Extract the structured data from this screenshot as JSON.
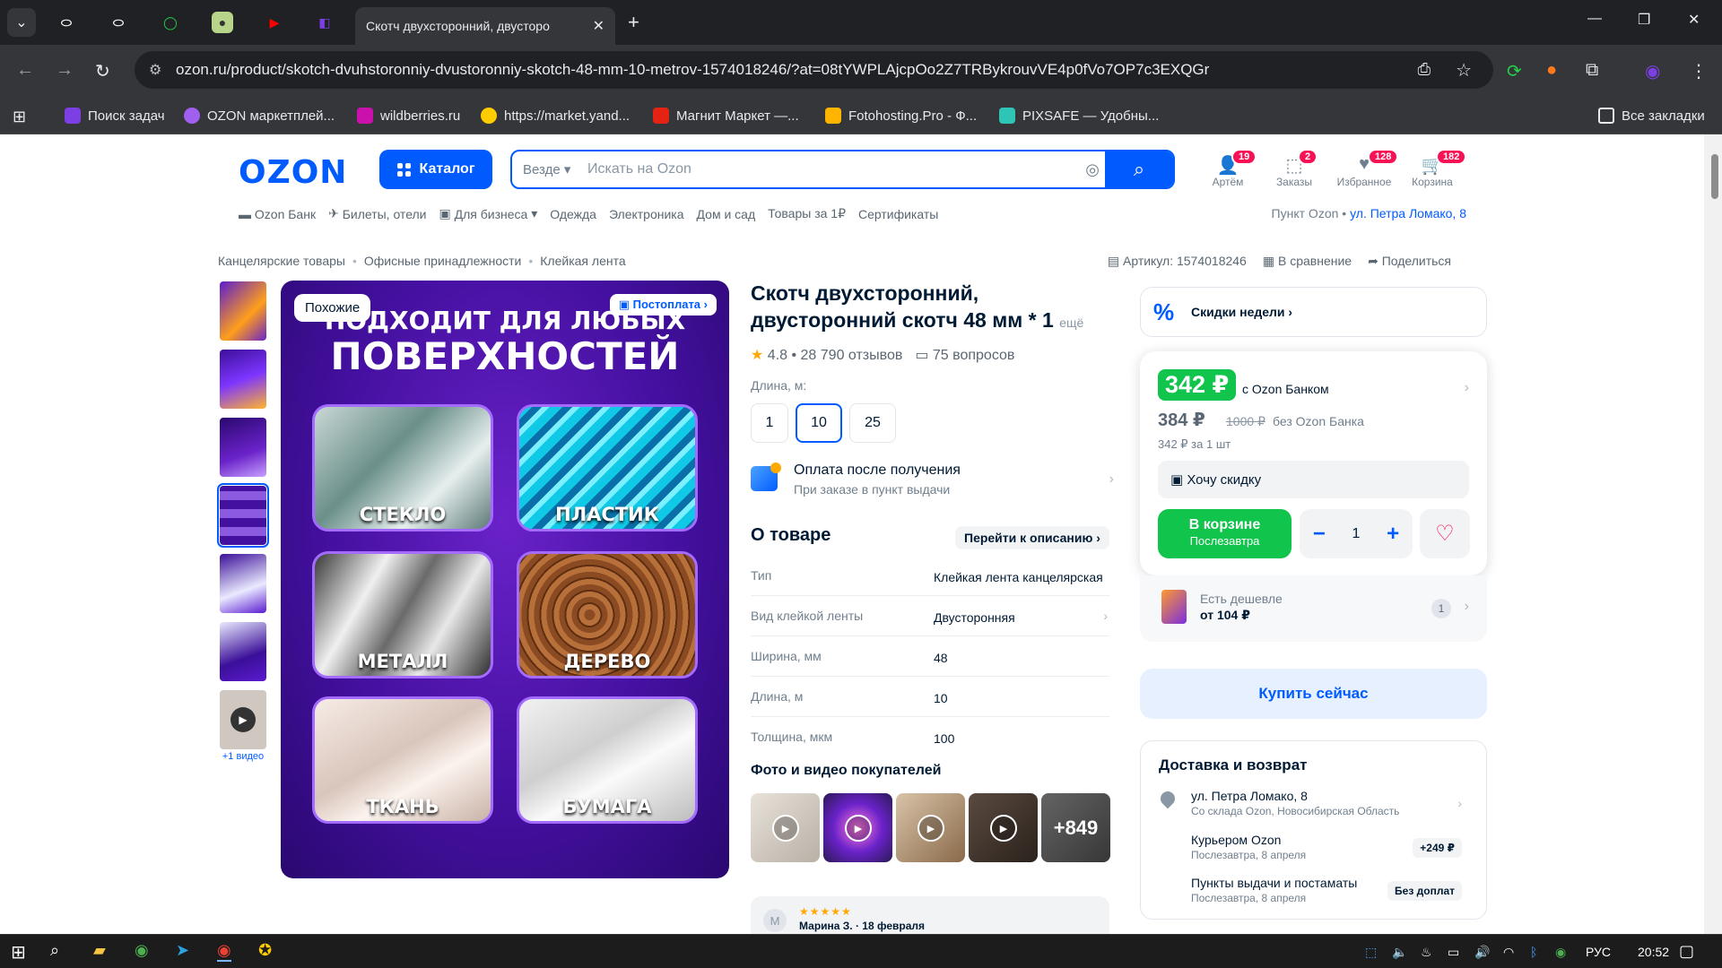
{
  "browser": {
    "active_tab_title": "Скотч двухсторонний, двусторо",
    "url": "ozon.ru/product/skotch-dvuhstoronniy-dvustoronniy-skotch-48-mm-10-metrov-1574018246/?at=08tYWPLAjcpOo2Z7TRBykrouvVE4p0fVo7OP7c3EXQGr",
    "bookmarks": [
      {
        "label": "Поиск задач",
        "color": "#7b3fe4"
      },
      {
        "label": "OZON маркетплей...",
        "color": "#a15ff0"
      },
      {
        "label": "wildberries.ru",
        "color": "#cb11ab"
      },
      {
        "label": "https://market.yand...",
        "color": "#ffcc00"
      },
      {
        "label": "Магнит Маркет —...",
        "color": "#e42313"
      },
      {
        "label": "Fotohosting.Pro - Ф...",
        "color": "#ffb400"
      },
      {
        "label": "PIXSAFE — Удобны...",
        "color": "#2ec4b6"
      }
    ],
    "all_bookmarks": "Все закладки"
  },
  "header": {
    "logo": "OZON",
    "catalog": "Каталог",
    "search_scope": "Везде",
    "search_placeholder": "Искать на Ozon",
    "icons": [
      {
        "label": "Артём",
        "badge": "19"
      },
      {
        "label": "Заказы",
        "badge": "2"
      },
      {
        "label": "Избранное",
        "badge": "128"
      },
      {
        "label": "Корзина",
        "badge": "182"
      }
    ],
    "subnav": [
      "Ozon Банк",
      "Билеты, отели",
      "Для бизнеса",
      "Одежда",
      "Электроника",
      "Дом и сад",
      "Товары за 1₽",
      "Сертификаты"
    ],
    "pickup_prefix": "Пункт Ozon •",
    "pickup_address": "ул. Петра Ломако, 8"
  },
  "breadcrumbs": [
    "Канцелярские товары",
    "Офисные принадлежности",
    "Клейкая лента"
  ],
  "meta": {
    "article": "Артикул: 1574018246",
    "compare": "В сравнение",
    "share": "Поделиться"
  },
  "gallery": {
    "more_video": "+1 видео",
    "badge_similar": "Похожие",
    "badge_postpay": "Постоплата",
    "headline_1": "ПОДХОДИТ ДЛЯ ЛЮБЫХ",
    "headline_2": "ПОВЕРХНОСТЕЙ",
    "tiles": [
      "СТЕКЛО",
      "ПЛАСТИК",
      "МЕТАЛЛ",
      "ДЕРЕВО",
      "ТКАНЬ",
      "БУМАГА"
    ]
  },
  "product": {
    "title": "Скотч двухсторонний, двусторонний скотч 48 мм",
    "title_mark": "* 1",
    "title_more": "ещё",
    "rating": "4.8 • 28 790 отзывов",
    "questions": "75 вопросов",
    "length_label": "Длина, м:",
    "lengths": [
      "1",
      "10",
      "25"
    ],
    "payment_title": "Оплата после получения",
    "payment_sub": "При заказе в пункт выдачи",
    "about": "О товаре",
    "to_description": "Перейти к описанию",
    "specs": [
      {
        "k": "Тип",
        "v": "Клейкая лента канцелярская"
      },
      {
        "k": "Вид клейкой ленты",
        "v": "Двусторонняя"
      },
      {
        "k": "Ширина, мм",
        "v": "48"
      },
      {
        "k": "Длина, м",
        "v": "10"
      },
      {
        "k": "Толщина, мкм",
        "v": "100"
      }
    ],
    "photos_title": "Фото и видео покупателей",
    "photos_more": "+849",
    "review_initial": "М",
    "review_author": "Марина З. · 18 февраля"
  },
  "buybox": {
    "week_deals": "Скидки недели",
    "price_bank": "342 ₽",
    "price_bank_label": "с Ozon Банком",
    "price_regular": "384 ₽",
    "price_old": "1000 ₽",
    "price_regular_label": "без Ozon Банка",
    "unit_price": "342 ₽ за 1 шт",
    "want_discount": "Хочу скидку",
    "in_cart": "В корзине",
    "in_cart_sub": "Послезавтра",
    "qty": "1",
    "cheaper_label": "Есть дешевле",
    "cheaper_price": "от 104 ₽",
    "cheaper_count": "1",
    "buy_now": "Купить сейчас"
  },
  "delivery": {
    "title": "Доставка и возврат",
    "items": [
      {
        "title": "ул. Петра Ломако, 8",
        "sub": "Со склада Ozon, Новосибирская Область",
        "tag": ""
      },
      {
        "title": "Курьером Ozon",
        "sub": "Послезавтра, 8 апреля",
        "tag": "+249 ₽"
      },
      {
        "title": "Пункты выдачи и постаматы",
        "sub": "Послезавтра, 8 апреля",
        "tag": "Без доплат"
      }
    ]
  },
  "taskbar": {
    "lang": "РУС",
    "time": "20:52"
  }
}
